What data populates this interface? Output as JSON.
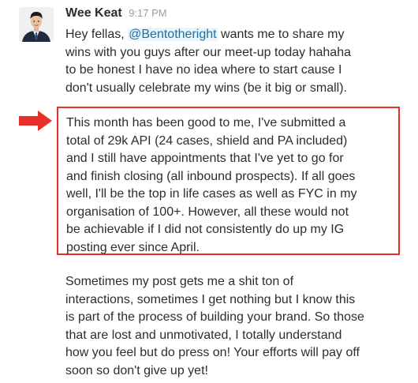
{
  "message": {
    "sender": "Wee Keat",
    "timestamp": "9:17 PM",
    "paragraph1": {
      "line1_before": "Hey fellas, ",
      "mention": "@Bentotheright",
      "line1_after": " wants me to share my",
      "line2": "wins with you guys after our meet-up today hahaha",
      "line3": "to be honest I have no idea where to start cause I",
      "line4": "don't usually celebrate my wins (be it big or small)."
    },
    "paragraph2": {
      "lines": [
        "This month has been good to me, I've submitted a",
        "total of 29k API (24 cases, shield and PA included)",
        "and I still have appointments that I've yet to go for",
        "and finish closing (all inbound prospects). If all goes",
        "well, I'll be the top in life cases as well as FYC in my",
        "organisation of 100+. However, all these would not",
        "be achievable if I did not consistently do up my IG",
        "posting ever since April."
      ]
    },
    "paragraph3": {
      "lines": [
        "Sometimes my post gets me a shit ton of",
        "interactions, sometimes I get nothing but I know this",
        "is part of the process of building your brand. So those",
        "that are lost and unmotivated, I totally understand",
        "how you feel but do press on! Your efforts will pay off",
        "soon so don't give up yet!"
      ]
    }
  },
  "colors": {
    "highlight_border": "#e8302b",
    "arrow": "#e8302b",
    "mention_text": "#1d6fa5",
    "mention_background": "#e8f5fa"
  }
}
